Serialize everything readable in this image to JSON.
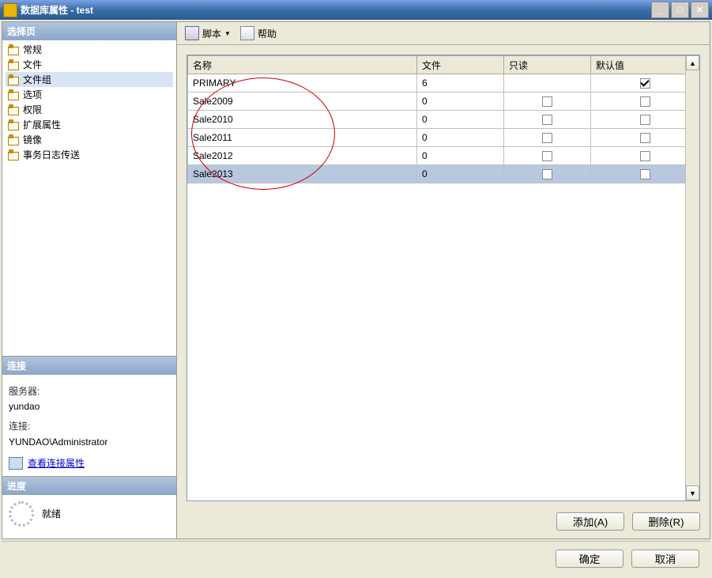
{
  "title": "数据库属性 - test",
  "left": {
    "select_page": "选择页",
    "tree": [
      {
        "label": "常规",
        "selected": false
      },
      {
        "label": "文件",
        "selected": false
      },
      {
        "label": "文件组",
        "selected": true
      },
      {
        "label": "选项",
        "selected": false
      },
      {
        "label": "权限",
        "selected": false
      },
      {
        "label": "扩展属性",
        "selected": false
      },
      {
        "label": "镜像",
        "selected": false
      },
      {
        "label": "事务日志传送",
        "selected": false
      }
    ],
    "conn_header": "连接",
    "server_label": "服务器:",
    "server_value": "yundao",
    "conn_label": "连接:",
    "conn_value": "YUNDAO\\Administrator",
    "view_props": "查看连接属性",
    "progress_header": "进度",
    "progress_status": "就绪"
  },
  "toolbar": {
    "script": "脚本",
    "help": "帮助"
  },
  "grid": {
    "headers": {
      "name": "名称",
      "files": "文件",
      "readonly": "只读",
      "default": "默认值"
    },
    "rows": [
      {
        "name": "PRIMARY",
        "files": "6",
        "readonly": null,
        "default": true,
        "selected": false
      },
      {
        "name": "Sale2009",
        "files": "0",
        "readonly": false,
        "default": false,
        "selected": false
      },
      {
        "name": "Sale2010",
        "files": "0",
        "readonly": false,
        "default": false,
        "selected": false
      },
      {
        "name": "Sale2011",
        "files": "0",
        "readonly": false,
        "default": false,
        "selected": false
      },
      {
        "name": "Sale2012",
        "files": "0",
        "readonly": false,
        "default": false,
        "selected": false
      },
      {
        "name": "Sale2013",
        "files": "0",
        "readonly": false,
        "default": false,
        "selected": true
      }
    ]
  },
  "buttons": {
    "add": "添加(A)",
    "remove": "删除(R)",
    "ok": "确定",
    "cancel": "取消"
  }
}
